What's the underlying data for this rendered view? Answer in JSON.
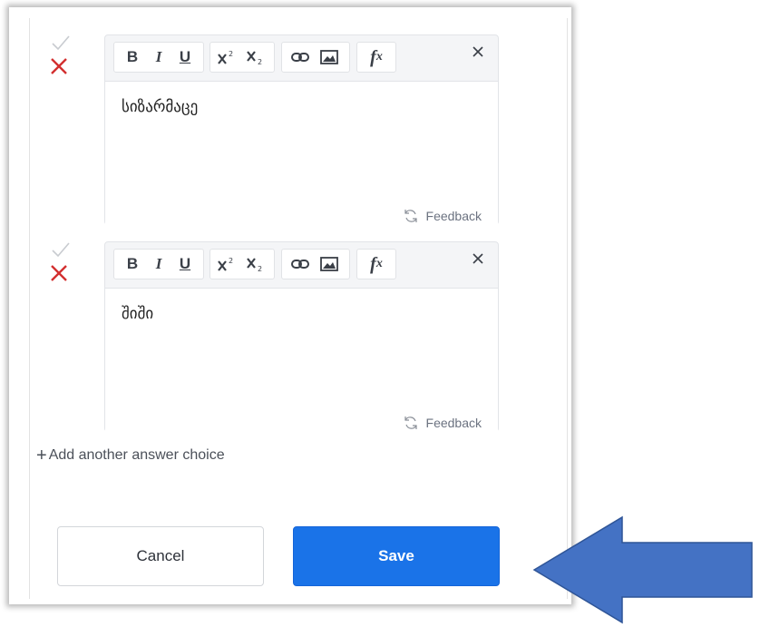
{
  "answers": [
    {
      "text": "სიზარმაცე",
      "feedback_label": "Feedback"
    },
    {
      "text": "შიში",
      "feedback_label": "Feedback"
    }
  ],
  "toolbar": {
    "bold": "B",
    "italic": "I",
    "underline": "U",
    "superscript_icon": "superscript-icon",
    "subscript_icon": "subscript-icon",
    "link_icon": "link-icon",
    "image_icon": "image-icon",
    "formula_icon": "function-icon",
    "close_icon": "close-icon"
  },
  "add_choice_plus": "+",
  "add_choice_label": "Add another answer choice",
  "cancel_label": "Cancel",
  "save_label": "Save",
  "colors": {
    "save_bg": "#1a73e8",
    "incorrect_x": "#d32f2f",
    "arrow": "#4472c4",
    "arrow_border": "#2f5597"
  }
}
